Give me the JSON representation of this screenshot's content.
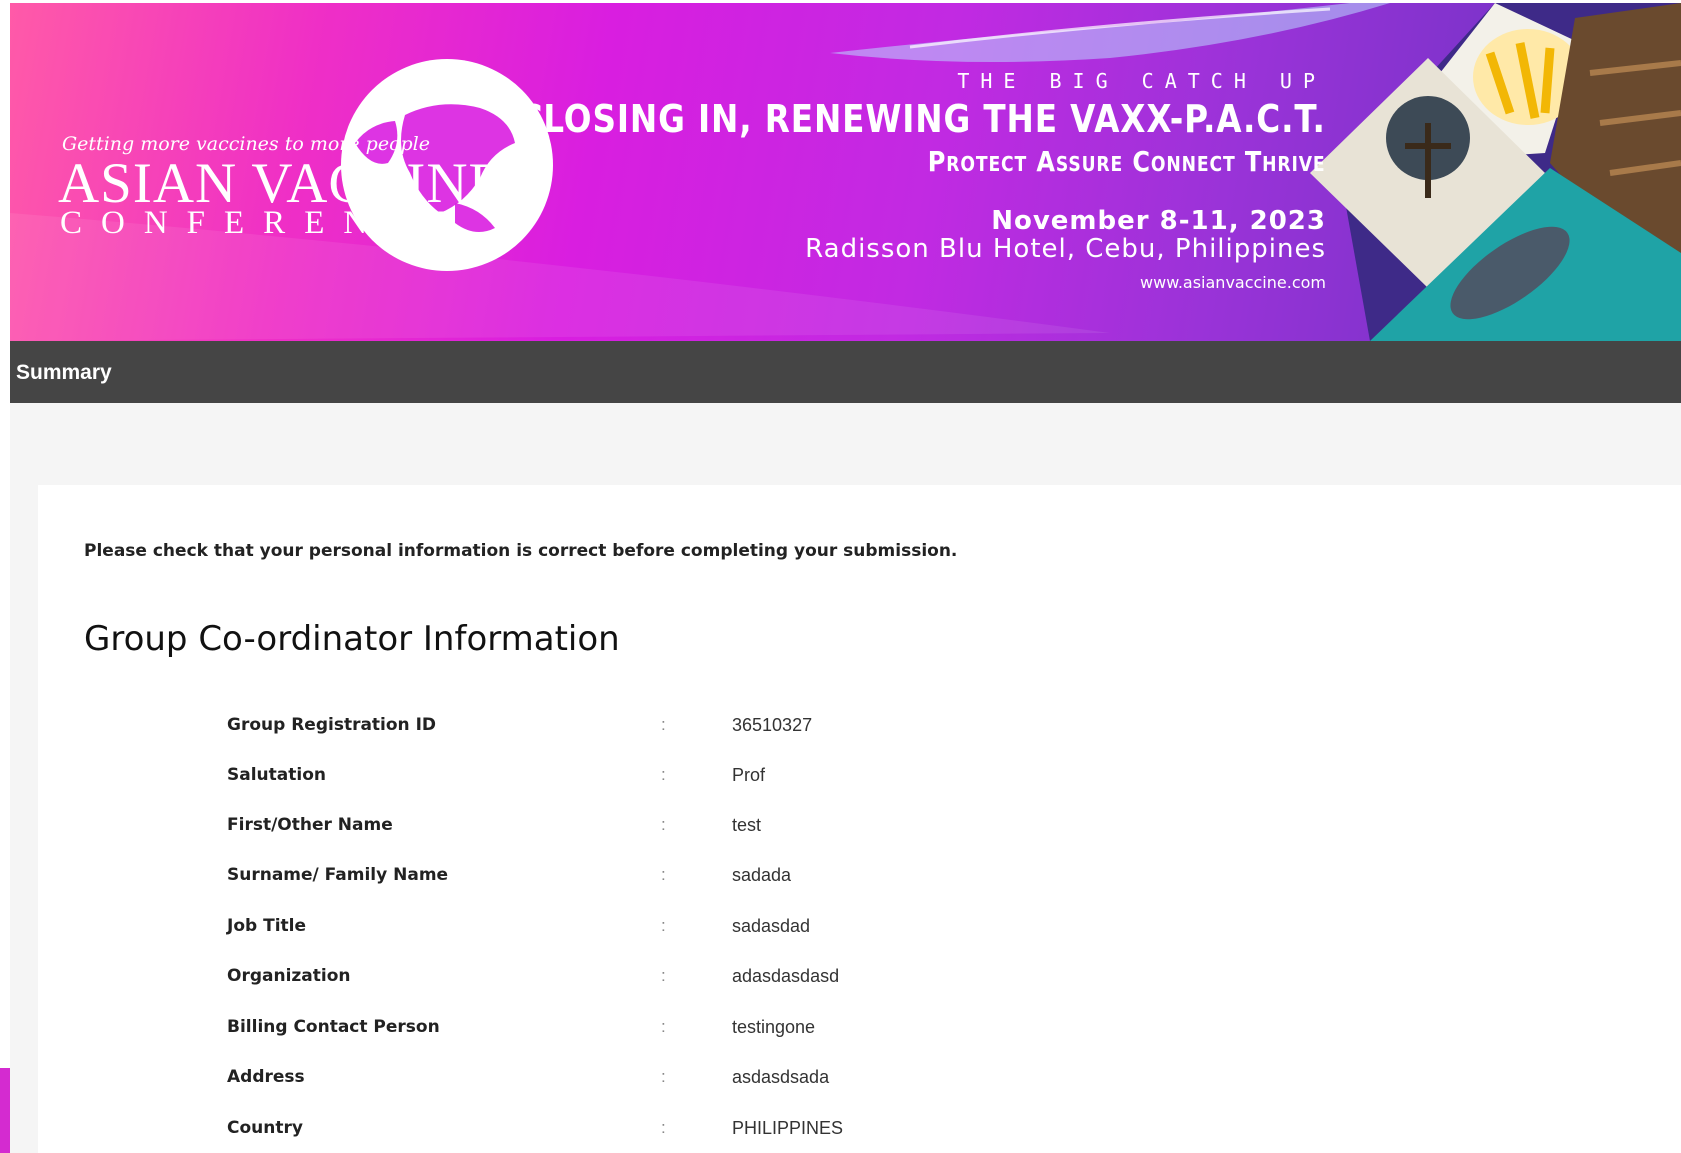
{
  "banner": {
    "logo_tagline": "Getting more vaccines to more people",
    "logo_title": "ASIAN VACCINE",
    "logo_subtitle": "CONFERENCE",
    "eyebrow": "THE BIG CATCH UP",
    "headline": "CLOSING IN, RENEWING THE VAXX-P.A.C.T.",
    "tagline": "Protect Assure Connect Thrive",
    "date": "November 8-11, 2023",
    "venue": "Radisson Blu Hotel, Cebu, Philippines",
    "url": "www.asianvaccine.com"
  },
  "summary": {
    "title": "Summary"
  },
  "content": {
    "notice": "Please check that your personal information is correct before completing your submission.",
    "section_title": "Group Co-ordinator Information",
    "separator": ":",
    "rows": [
      {
        "label": "Group Registration ID",
        "value": "36510327"
      },
      {
        "label": "Salutation",
        "value": "Prof"
      },
      {
        "label": "First/Other Name",
        "value": "test"
      },
      {
        "label": "Surname/ Family Name",
        "value": "sadada"
      },
      {
        "label": "Job Title",
        "value": "sadasdad"
      },
      {
        "label": "Organization",
        "value": "adasdasdasd"
      },
      {
        "label": "Billing Contact Person",
        "value": "testingone"
      },
      {
        "label": "Address",
        "value": "asdasdsada"
      },
      {
        "label": "Country",
        "value": "PHILIPPINES"
      }
    ]
  },
  "colors": {
    "summary_bar": "#454545",
    "banner_pink": "#ef2fc6",
    "banner_purple": "#7a33c9",
    "page_bg": "#f5f5f5"
  }
}
